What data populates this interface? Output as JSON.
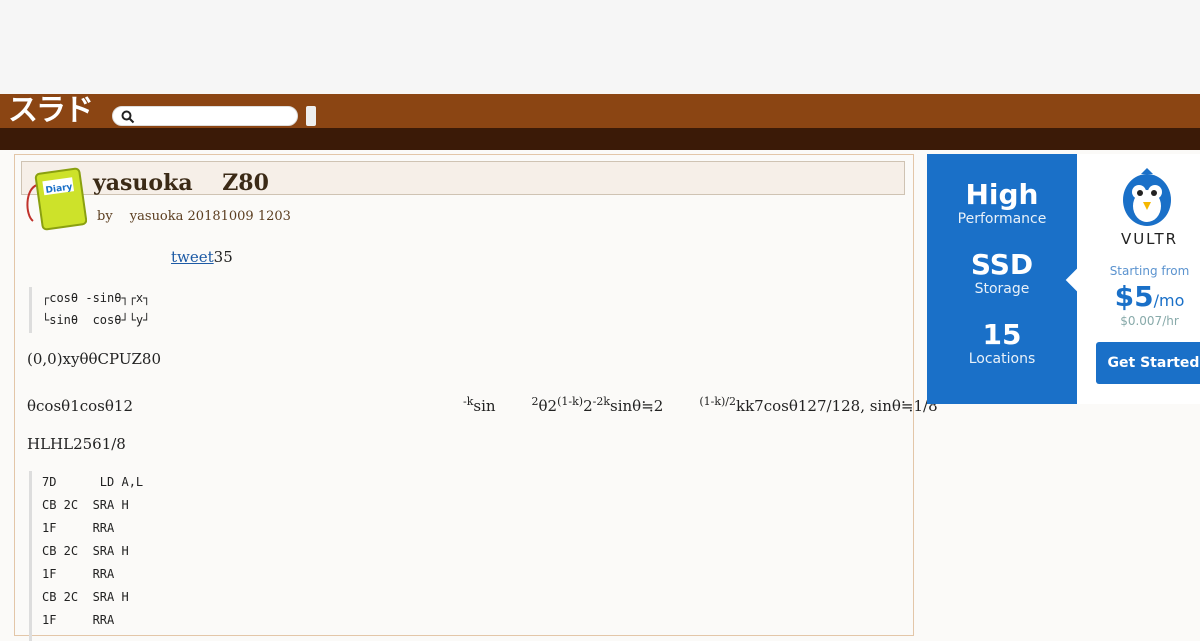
{
  "site": {
    "logo": "スラド"
  },
  "search": {
    "placeholder": ""
  },
  "story": {
    "title": "yasuoka　 Z80",
    "byline": "by　 yasuoka 20181009 1203",
    "tweet_label": "tweet",
    "tweet_count": "35"
  },
  "matrix": [
    "┌cosθ -sinθ┐┌x┐",
    "└sinθ  cosθ┘└y┘"
  ],
  "paragraphs": {
    "p1": "(0,0)xyθθCPUZ80",
    "p2": {
      "a": "θcosθ1cosθ12",
      "b": "-k",
      "c": "sin",
      "d": "2",
      "e": "θ2",
      "f": "(1-k)",
      "g": "2",
      "h": "-2k",
      "i": "sinθ≒2",
      "j": "(1-k)/2",
      "k": "kk7cosθ127/128, sinθ≒1/8"
    },
    "p3": "HLHL2561/8"
  },
  "code_lines": [
    "7D      LD A,L",
    "CB 2C  SRA H",
    "1F     RRA",
    "CB 2C  SRA H",
    "1F     RRA",
    "CB 2C  SRA H",
    "1F     RRA"
  ],
  "ad": {
    "high": "High",
    "performance": "Performance",
    "ssd": "SSD",
    "storage": "Storage",
    "locations_count": "15",
    "locations": "Locations",
    "brand": "VULTR",
    "starting": "Starting from",
    "price": "$5",
    "per": "/mo",
    "hourly": "$0.007/hr",
    "cta": "Get Started",
    "colors": {
      "blue": "#1a70c8"
    }
  },
  "colors": {
    "header": "#8b4513",
    "subheader": "#3b1a07"
  }
}
